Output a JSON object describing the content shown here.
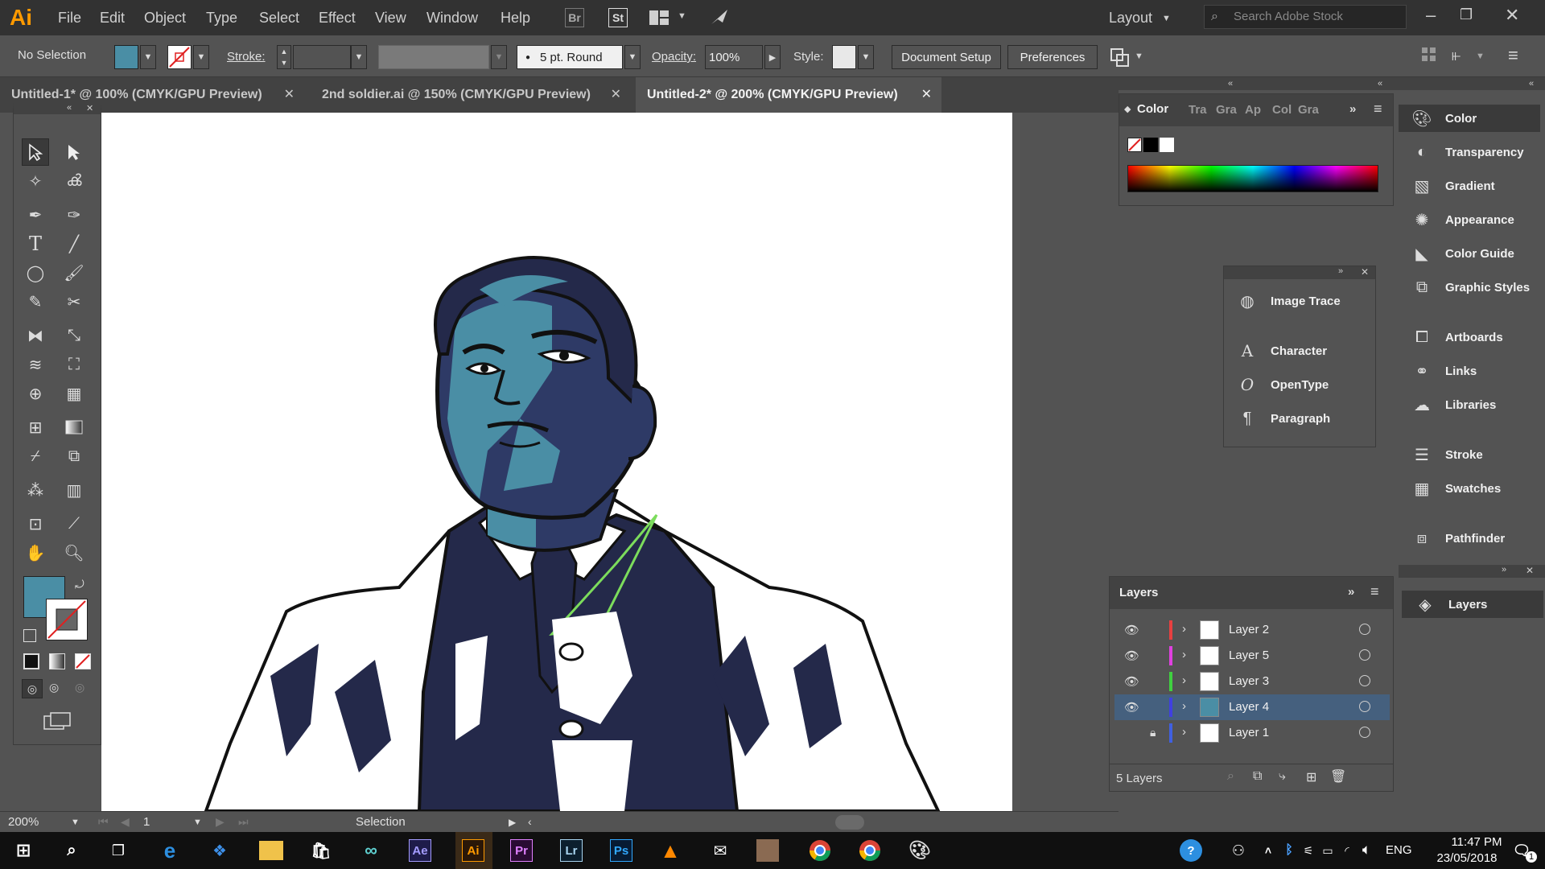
{
  "app": {
    "logo": "Ai",
    "menus": [
      "File",
      "Edit",
      "Object",
      "Type",
      "Select",
      "Effect",
      "View",
      "Window",
      "Help"
    ],
    "bridge_badge": "Br",
    "stock_badge": "St",
    "workspace": "Layout",
    "search_placeholder": "Search Adobe Stock"
  },
  "controlbar": {
    "selection_label": "No Selection",
    "stroke_label": "Stroke:",
    "brush_value": "5 pt. Round",
    "opacity_label": "Opacity:",
    "opacity_value": "100%",
    "style_label": "Style:",
    "document_setup": "Document Setup",
    "preferences": "Preferences",
    "fill_color": "#4a8ea5"
  },
  "tabs": [
    {
      "label": "Untitled-1* @ 100% (CMYK/GPU Preview)"
    },
    {
      "label": "2nd soldier.ai @ 150% (CMYK/GPU Preview)"
    },
    {
      "label": "Untitled-2* @ 200% (CMYK/GPU Preview)"
    }
  ],
  "status": {
    "zoom": "200%",
    "artboard": "1",
    "tool": "Selection"
  },
  "color_panel": {
    "title": "Color",
    "tabs": [
      "Tra",
      "Gra",
      "Ap",
      "Col",
      "Gra"
    ]
  },
  "float_panel": {
    "items": [
      "Image Trace",
      "Character",
      "OpenType",
      "Paragraph"
    ]
  },
  "dock": {
    "group1": [
      "Color",
      "Transparency",
      "Gradient",
      "Appearance",
      "Color Guide",
      "Graphic Styles"
    ],
    "group2": [
      "Artboards",
      "Links",
      "Libraries"
    ],
    "group3": [
      "Stroke",
      "Swatches"
    ],
    "group4": [
      "Pathfinder"
    ],
    "layers": "Layers"
  },
  "layers_panel": {
    "title": "Layers",
    "footer": "5 Layers",
    "rows": [
      {
        "name": "Layer 2",
        "color": "#e84040"
      },
      {
        "name": "Layer 5",
        "color": "#e040e0"
      },
      {
        "name": "Layer 3",
        "color": "#40d040"
      },
      {
        "name": "Layer 4",
        "color": "#4040e0"
      },
      {
        "name": "Layer 1",
        "color": "#4060e0"
      }
    ]
  },
  "taskbar": {
    "apps": [
      "Ae",
      "Ai",
      "Pr",
      "Lr",
      "Ps"
    ],
    "lang": "ENG",
    "time": "11:47 PM",
    "date": "23/05/2018",
    "notif": "1"
  },
  "colors": {
    "teal": "#4a8ea5",
    "navy": "#24294a",
    "accent": "#ff9a00"
  }
}
